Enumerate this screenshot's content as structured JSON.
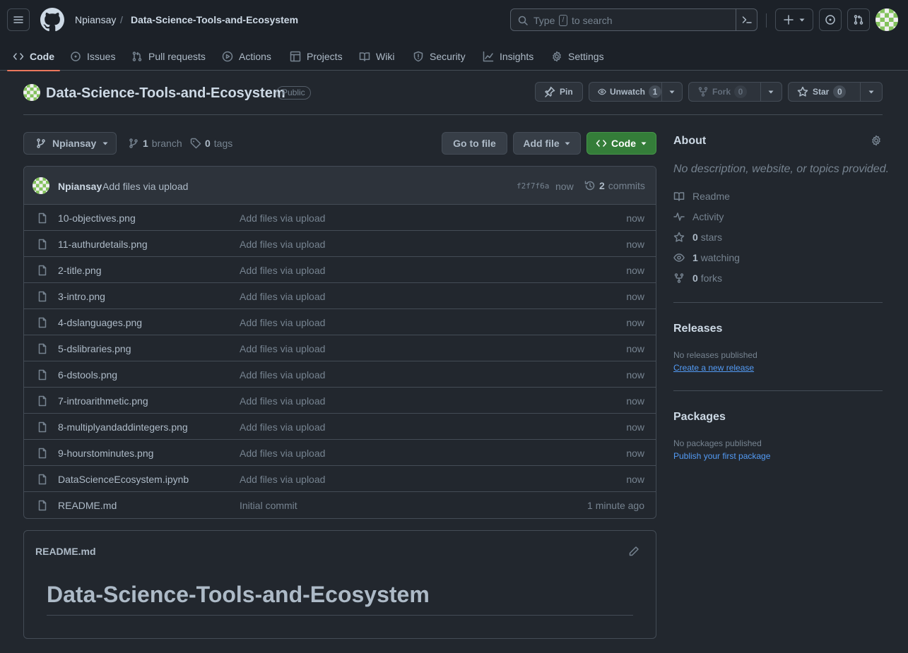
{
  "header": {
    "owner": "Npiansay",
    "separator": "/",
    "repo": "Data-Science-Tools-and-Ecosystem",
    "search_prefix": "Type",
    "search_key": "/",
    "search_suffix": "to search"
  },
  "tabs": [
    {
      "label": "Code",
      "icon": "code-icon"
    },
    {
      "label": "Issues",
      "icon": "issue-icon"
    },
    {
      "label": "Pull requests",
      "icon": "pull-request-icon"
    },
    {
      "label": "Actions",
      "icon": "play-icon"
    },
    {
      "label": "Projects",
      "icon": "table-icon"
    },
    {
      "label": "Wiki",
      "icon": "book-icon"
    },
    {
      "label": "Security",
      "icon": "shield-icon"
    },
    {
      "label": "Insights",
      "icon": "graph-icon"
    },
    {
      "label": "Settings",
      "icon": "gear-icon"
    }
  ],
  "repo": {
    "title": "Data-Science-Tools-and-Ecosystem",
    "visibility": "Public",
    "pin_label": "Pin",
    "watch_label": "Unwatch",
    "watch_count": "1",
    "fork_label": "Fork",
    "fork_count": "0",
    "star_label": "Star",
    "star_count": "0"
  },
  "toolbar": {
    "branch": "Npiansay",
    "branch_count": "1",
    "branch_word": "branch",
    "tag_count": "0",
    "tag_word": "tags",
    "goto_label": "Go to file",
    "add_file_label": "Add file",
    "code_label": "Code"
  },
  "commit": {
    "author": "Npiansay",
    "message": "Add files via upload",
    "sha": "f2f7f6a",
    "time": "now",
    "count": "2",
    "count_word": "commits"
  },
  "files": [
    {
      "name": "10-objectives.png",
      "message": "Add files via upload",
      "time": "now"
    },
    {
      "name": "11-authurdetails.png",
      "message": "Add files via upload",
      "time": "now"
    },
    {
      "name": "2-title.png",
      "message": "Add files via upload",
      "time": "now"
    },
    {
      "name": "3-intro.png",
      "message": "Add files via upload",
      "time": "now"
    },
    {
      "name": "4-dslanguages.png",
      "message": "Add files via upload",
      "time": "now"
    },
    {
      "name": "5-dslibraries.png",
      "message": "Add files via upload",
      "time": "now"
    },
    {
      "name": "6-dstools.png",
      "message": "Add files via upload",
      "time": "now"
    },
    {
      "name": "7-introarithmetic.png",
      "message": "Add files via upload",
      "time": "now"
    },
    {
      "name": "8-multiplyandaddintegers.png",
      "message": "Add files via upload",
      "time": "now"
    },
    {
      "name": "9-hourstominutes.png",
      "message": "Add files via upload",
      "time": "now"
    },
    {
      "name": "DataScienceEcosystem.ipynb",
      "message": "Add files via upload",
      "time": "now"
    },
    {
      "name": "README.md",
      "message": "Initial commit",
      "time": "1 minute ago"
    }
  ],
  "readme": {
    "filename": "README.md",
    "heading": "Data-Science-Tools-and-Ecosystem"
  },
  "about": {
    "title": "About",
    "description": "No description, website, or topics provided.",
    "readme_label": "Readme",
    "activity_label": "Activity",
    "stars_count": "0",
    "stars_word": "stars",
    "watching_count": "1",
    "watching_word": "watching",
    "forks_count": "0",
    "forks_word": "forks"
  },
  "releases": {
    "title": "Releases",
    "empty": "No releases published",
    "link": "Create a new release"
  },
  "packages": {
    "title": "Packages",
    "empty": "No packages published",
    "link": "Publish your first package"
  },
  "colors": {
    "background": "#22272e",
    "header": "#1c2128",
    "accent_tab": "#ec775c",
    "code_button": "#347d39",
    "link": "#539bf5"
  }
}
